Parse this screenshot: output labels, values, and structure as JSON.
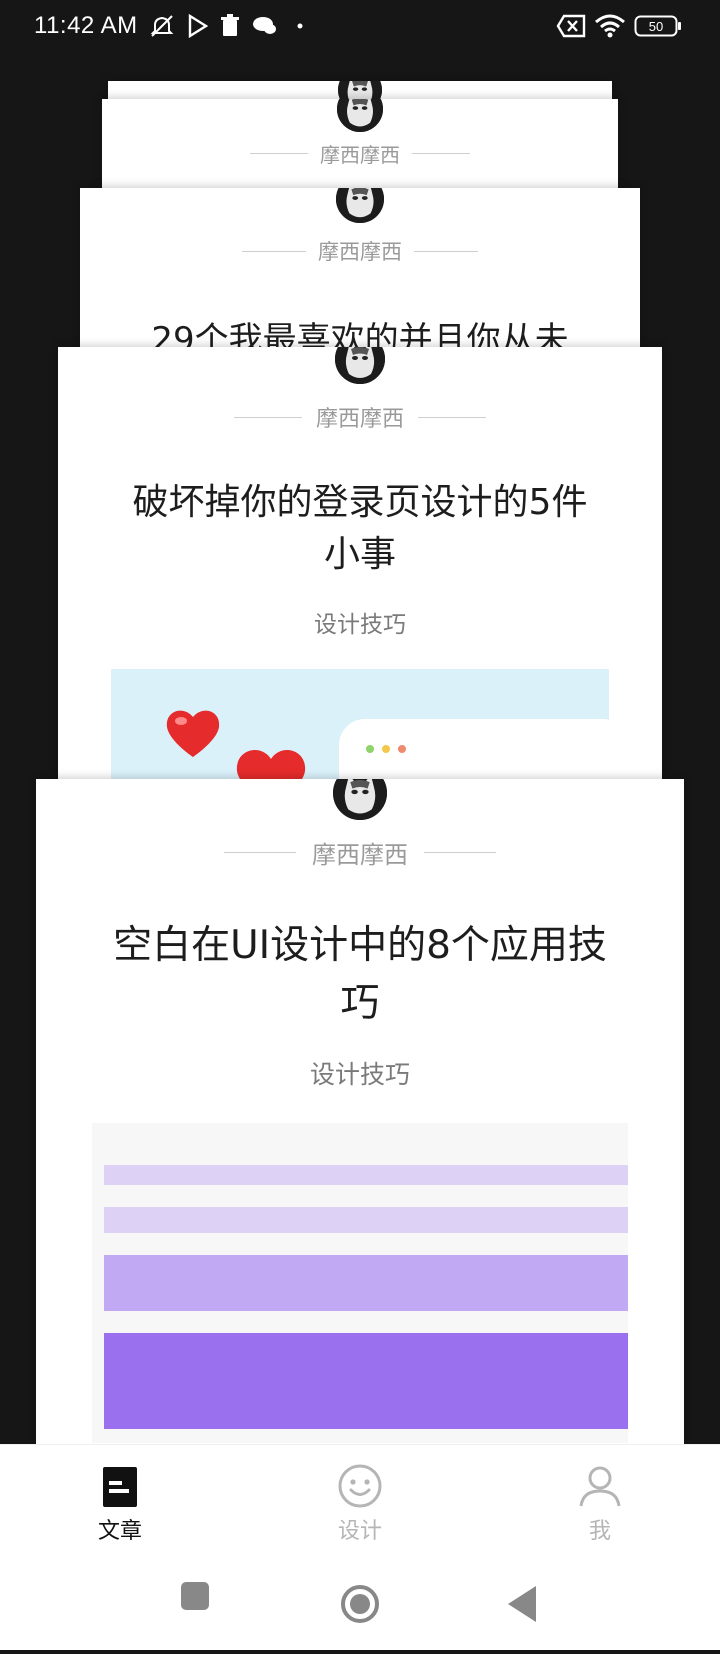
{
  "status_bar": {
    "time": "11:42 AM",
    "battery": "50"
  },
  "cards": [
    {
      "author": "摩西摩西",
      "title": "",
      "category": ""
    },
    {
      "author": "摩西摩西",
      "title": "",
      "category": ""
    },
    {
      "author": "摩西摩西",
      "title": "29个我最喜欢的并且你从未",
      "category": ""
    },
    {
      "author": "摩西摩西",
      "title": "破坏掉你的登录页设计的5件小事",
      "category": "设计技巧"
    },
    {
      "author": "摩西摩西",
      "title": "空白在UI设计中的8个应用技巧",
      "category": "设计技巧"
    }
  ],
  "bottom_nav": {
    "items": [
      {
        "label": "文章",
        "icon": "article-icon",
        "active": true
      },
      {
        "label": "设计",
        "icon": "smile-icon",
        "active": false
      },
      {
        "label": "我",
        "icon": "person-icon",
        "active": false
      }
    ]
  },
  "colors": {
    "active": "#111111",
    "inactive": "#b5b5b5",
    "purple_dark": "#9a70ee",
    "purple_mid": "#c2a9f3",
    "purple_light": "#ddd1f5",
    "sky": "#daf1fa"
  }
}
